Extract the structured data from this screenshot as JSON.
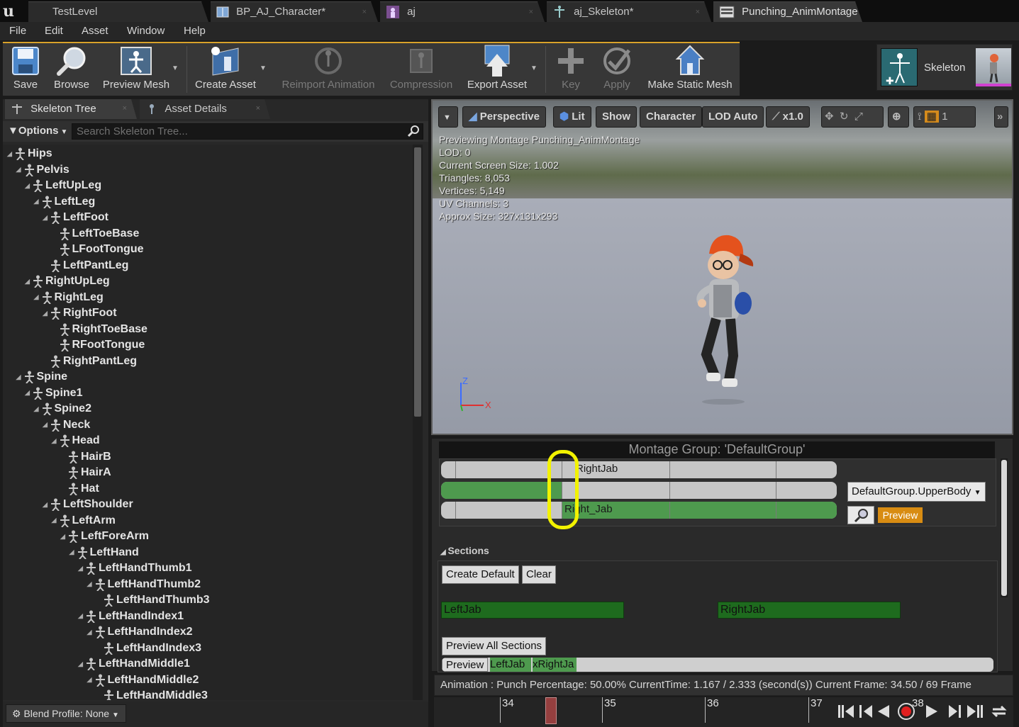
{
  "tabs": [
    {
      "label": "TestLevel",
      "icon": "unreal-logo-icon"
    },
    {
      "label": "BP_AJ_Character*",
      "icon": "blueprint-icon"
    },
    {
      "label": "aj",
      "icon": "mesh-icon"
    },
    {
      "label": "aj_Skeleton*",
      "icon": "skeleton-icon"
    },
    {
      "label": "Punching_AnimMontage*",
      "icon": "montage-icon"
    }
  ],
  "menu": [
    "File",
    "Edit",
    "Asset",
    "Window",
    "Help"
  ],
  "toolbar": {
    "save": "Save",
    "browse": "Browse",
    "preview_mesh": "Preview Mesh",
    "create_asset": "Create Asset",
    "reimport_animation": "Reimport Animation",
    "compression": "Compression",
    "export_asset": "Export Asset",
    "key": "Key",
    "apply": "Apply",
    "make_static_mesh": "Make Static Mesh",
    "skeleton": "Skeleton"
  },
  "left_panel": {
    "tab_skeleton_tree": "Skeleton Tree",
    "tab_asset_details": "Asset Details",
    "options": "Options",
    "search_placeholder": "Search Skeleton Tree...",
    "blend_profile": "Blend Profile: None"
  },
  "tree": [
    {
      "label": "Hips",
      "depth": 0,
      "expanded": true
    },
    {
      "label": "Pelvis",
      "depth": 1,
      "expanded": true
    },
    {
      "label": "LeftUpLeg",
      "depth": 2,
      "expanded": true
    },
    {
      "label": "LeftLeg",
      "depth": 3,
      "expanded": true
    },
    {
      "label": "LeftFoot",
      "depth": 4,
      "expanded": true
    },
    {
      "label": "LeftToeBase",
      "depth": 5,
      "expanded": false
    },
    {
      "label": "LFootTongue",
      "depth": 5,
      "expanded": false
    },
    {
      "label": "LeftPantLeg",
      "depth": 4,
      "expanded": false
    },
    {
      "label": "RightUpLeg",
      "depth": 2,
      "expanded": true
    },
    {
      "label": "RightLeg",
      "depth": 3,
      "expanded": true
    },
    {
      "label": "RightFoot",
      "depth": 4,
      "expanded": true
    },
    {
      "label": "RightToeBase",
      "depth": 5,
      "expanded": false
    },
    {
      "label": "RFootTongue",
      "depth": 5,
      "expanded": false
    },
    {
      "label": "RightPantLeg",
      "depth": 4,
      "expanded": false
    },
    {
      "label": "Spine",
      "depth": 1,
      "expanded": true
    },
    {
      "label": "Spine1",
      "depth": 2,
      "expanded": true
    },
    {
      "label": "Spine2",
      "depth": 3,
      "expanded": true
    },
    {
      "label": "Neck",
      "depth": 4,
      "expanded": true
    },
    {
      "label": "Head",
      "depth": 5,
      "expanded": true
    },
    {
      "label": "HairB",
      "depth": 6,
      "expanded": false
    },
    {
      "label": "HairA",
      "depth": 6,
      "expanded": false
    },
    {
      "label": "Hat",
      "depth": 6,
      "expanded": false
    },
    {
      "label": "LeftShoulder",
      "depth": 4,
      "expanded": true
    },
    {
      "label": "LeftArm",
      "depth": 5,
      "expanded": true
    },
    {
      "label": "LeftForeArm",
      "depth": 6,
      "expanded": true
    },
    {
      "label": "LeftHand",
      "depth": 7,
      "expanded": true
    },
    {
      "label": "LeftHandThumb1",
      "depth": 8,
      "expanded": true
    },
    {
      "label": "LeftHandThumb2",
      "depth": 9,
      "expanded": true
    },
    {
      "label": "LeftHandThumb3",
      "depth": 10,
      "expanded": false
    },
    {
      "label": "LeftHandIndex1",
      "depth": 8,
      "expanded": true
    },
    {
      "label": "LeftHandIndex2",
      "depth": 9,
      "expanded": true
    },
    {
      "label": "LeftHandIndex3",
      "depth": 10,
      "expanded": false
    },
    {
      "label": "LeftHandMiddle1",
      "depth": 8,
      "expanded": true
    },
    {
      "label": "LeftHandMiddle2",
      "depth": 9,
      "expanded": true
    },
    {
      "label": "LeftHandMiddle3",
      "depth": 10,
      "expanded": false
    }
  ],
  "viewport": {
    "perspective": "Perspective",
    "lit": "Lit",
    "show": "Show",
    "character": "Character",
    "lod": "LOD Auto",
    "speed": "x1.0",
    "info": [
      "Previewing Montage Punching_AnimMontage",
      "LOD: 0",
      "Current Screen Size: 1.002",
      "Triangles: 8,053",
      "Vertices: 5,149",
      "UV Channels: 3",
      "Approx Size: 327x131x293"
    ],
    "axis_z": "Z",
    "axis_x": "X"
  },
  "montage": {
    "group_header": "Montage Group: 'DefaultGroup'",
    "slot_top_label": "RightJab",
    "slot_bottom_label": "Right_Jab",
    "slot_name": "DefaultGroup.UpperBody",
    "preview": "Preview",
    "sections_title": "Sections",
    "create_default": "Create Default",
    "clear": "Clear",
    "section_left": "LeftJab",
    "section_right": "RightJab",
    "preview_all_sections": "Preview All Sections",
    "preview_row_btn": "Preview",
    "preview_row_seg1": "LeftJab",
    "preview_row_seg2": "xRightJa"
  },
  "status": {
    "text": "Animation :  Punch Percentage:  50.00% CurrentTime:  1.167 / 2.333 (second(s)) Current Frame:  34.50 / 69 Frame"
  },
  "timeline": {
    "ticks": [
      "34",
      "35",
      "36",
      "37",
      "38"
    ]
  },
  "colors": {
    "accent": "#d8a22a",
    "section_green": "#1e6b1e",
    "slot_green": "#4e9a4e",
    "preview_orange": "#d88c12",
    "highlight_yellow": "#f2f200"
  }
}
